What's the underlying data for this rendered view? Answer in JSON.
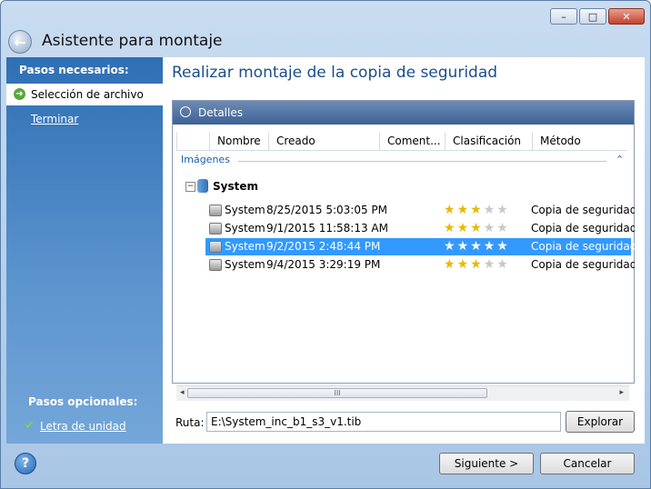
{
  "window": {
    "title": "Asistente para montaje",
    "min_glyph": "–",
    "max_glyph": "□",
    "close_glyph": "✕",
    "back_glyph": "←"
  },
  "sidebar": {
    "required_heading": "Pasos necesarios:",
    "items": [
      {
        "label": "Selección de archivo",
        "selected": true,
        "arrow": "➔"
      },
      {
        "label": "Terminar"
      }
    ],
    "optional_heading": "Pasos opcionales:",
    "optional_items": [
      {
        "label": "Letra de unidad",
        "check": "✔"
      }
    ]
  },
  "main": {
    "title": "Realizar montaje de la copia de seguridad",
    "details_label": "Detalles",
    "columns": [
      "Nombre",
      "Creado",
      "Coment...",
      "Clasificación",
      "Método"
    ],
    "group_label": "Imágenes",
    "group_caret": "⌃",
    "node": {
      "label": "System",
      "toggle": "−"
    },
    "rows": [
      {
        "name": "System",
        "date": "8/25/2015 5:03:05 PM",
        "rating": 3,
        "method": "Copia de seguridad c",
        "selected": false
      },
      {
        "name": "System",
        "date": "9/1/2015 11:58:13 AM",
        "rating": 3,
        "method": "Copia de seguridad ir",
        "selected": false
      },
      {
        "name": "System",
        "date": "9/2/2015 2:48:44 PM",
        "rating": 5,
        "method": "Copia de seguridad ir",
        "selected": true
      },
      {
        "name": "System",
        "date": "9/4/2015 3:29:19 PM",
        "rating": 3,
        "method": "Copia de seguridad ir",
        "selected": false
      }
    ],
    "scroll_left": "◂",
    "scroll_right": "▸",
    "scroll_grip": "III",
    "path_label": "Ruta:",
    "path_value": "E:\\System_inc_b1_s3_v1.tib",
    "browse_label": "Explorar"
  },
  "footer": {
    "help_glyph": "?",
    "next_label": "Siguiente >",
    "cancel_label": "Cancelar"
  },
  "colors": {
    "selection": "#3399ff",
    "sidebar": "#2f6fb4",
    "title": "#1a4d8f"
  }
}
